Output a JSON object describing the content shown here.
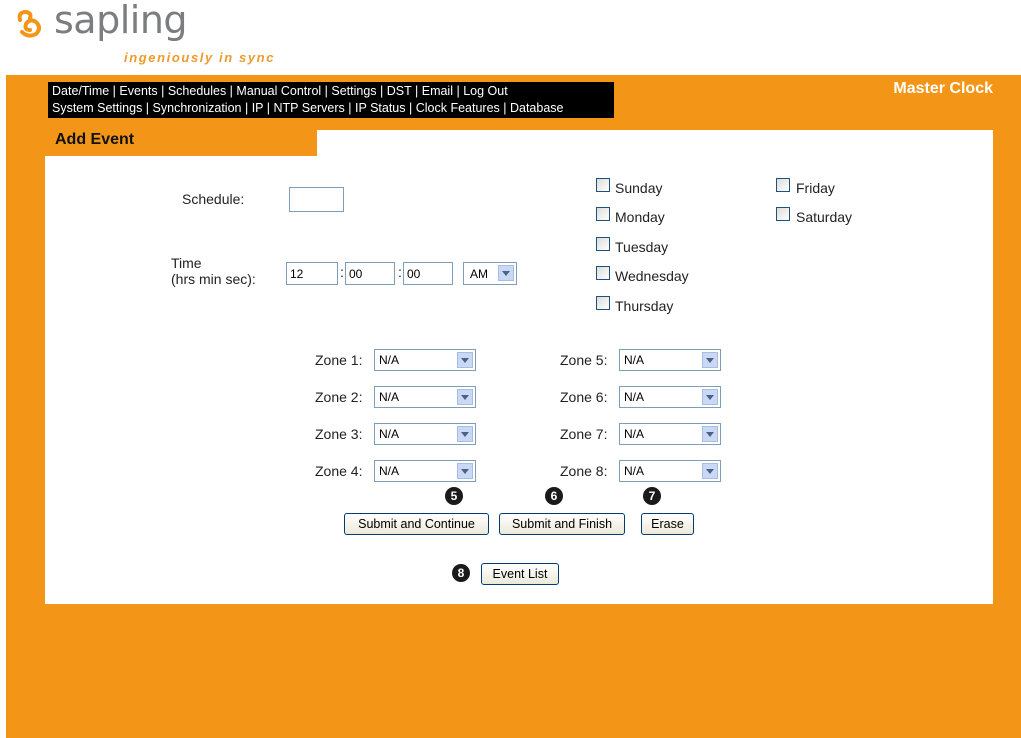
{
  "brand": {
    "name": "sapling",
    "tagline": "ingeniously in sync",
    "accent_color": "#f39517",
    "logo_icon": "sapling-swirl-icon"
  },
  "nav": {
    "row1": [
      "Date/Time",
      "Events",
      "Schedules",
      "Manual Control",
      "Settings",
      "DST",
      "Email",
      "Log Out"
    ],
    "row2": [
      "System Settings",
      "Synchronization",
      "IP",
      "NTP Servers",
      "IP Status",
      "Clock Features",
      "Database"
    ]
  },
  "header": {
    "right_title": "Master Clock"
  },
  "page": {
    "title": "Add Event"
  },
  "form": {
    "schedule_label": "Schedule:",
    "schedule_value": "",
    "time_label_line1": "Time",
    "time_label_line2": "(hrs min sec):",
    "hours": "12",
    "minutes": "00",
    "seconds": "00",
    "colon": ":",
    "ampm": "AM",
    "days": [
      {
        "label": "Sunday",
        "checked": false
      },
      {
        "label": "Monday",
        "checked": false
      },
      {
        "label": "Tuesday",
        "checked": false
      },
      {
        "label": "Wednesday",
        "checked": false
      },
      {
        "label": "Thursday",
        "checked": false
      },
      {
        "label": "Friday",
        "checked": false
      },
      {
        "label": "Saturday",
        "checked": false
      }
    ],
    "zones": [
      {
        "label": "Zone 1:",
        "value": "N/A"
      },
      {
        "label": "Zone 2:",
        "value": "N/A"
      },
      {
        "label": "Zone 3:",
        "value": "N/A"
      },
      {
        "label": "Zone 4:",
        "value": "N/A"
      },
      {
        "label": "Zone 5:",
        "value": "N/A"
      },
      {
        "label": "Zone 6:",
        "value": "N/A"
      },
      {
        "label": "Zone 7:",
        "value": "N/A"
      },
      {
        "label": "Zone 8:",
        "value": "N/A"
      }
    ]
  },
  "buttons": {
    "submit_continue": "Submit and Continue",
    "submit_finish": "Submit and Finish",
    "erase": "Erase",
    "event_list": "Event List"
  },
  "callouts": {
    "c5": "5",
    "c6": "6",
    "c7": "7",
    "c8": "8"
  }
}
